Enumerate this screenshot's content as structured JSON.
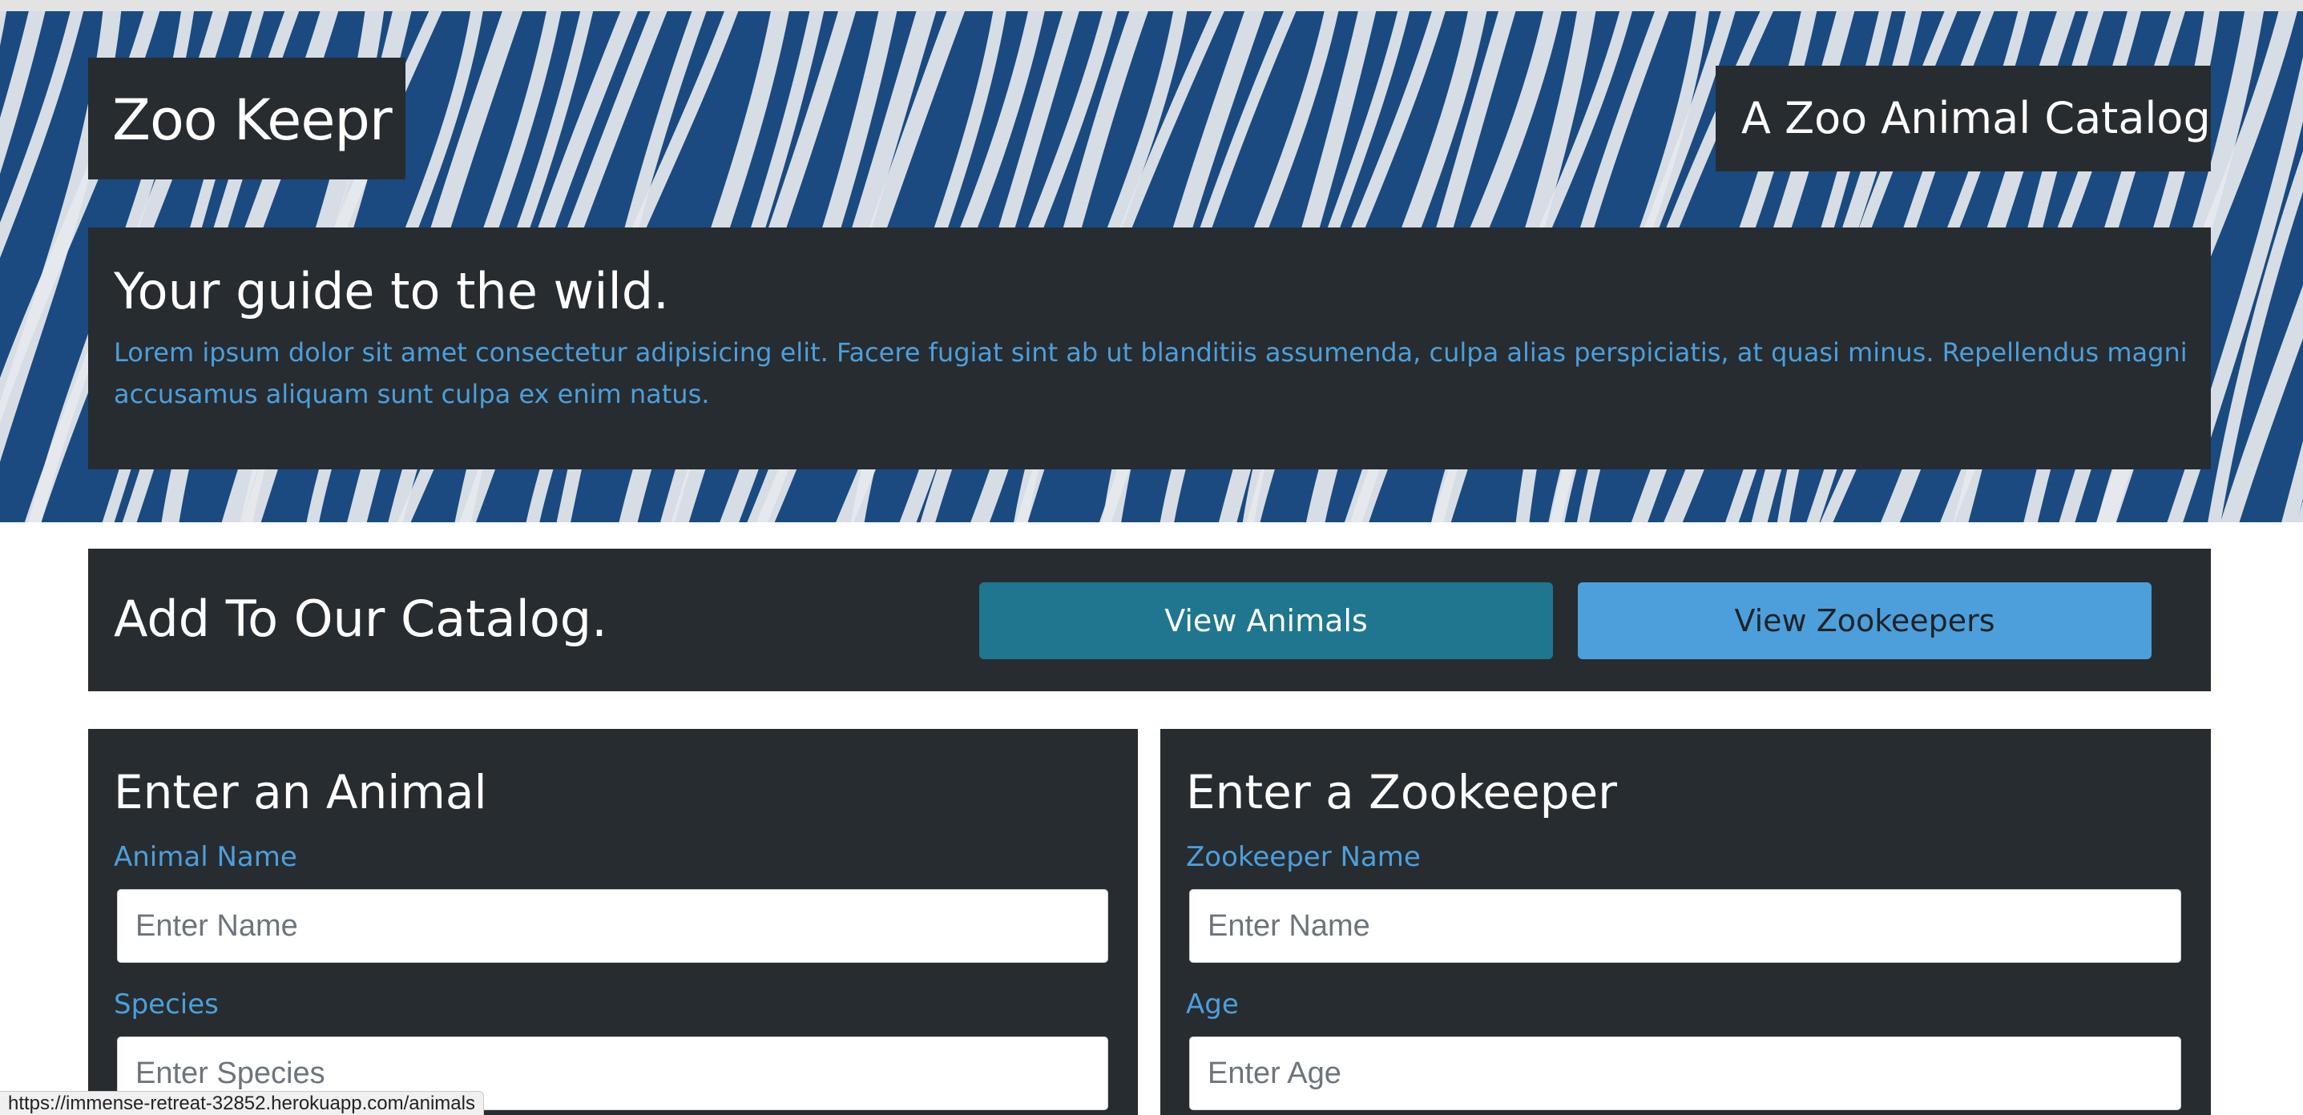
{
  "colors": {
    "panel": "#272c30",
    "accent_blue": "#4d9fdb",
    "teal_button": "#1f768e",
    "hero_blue": "#1a4a80",
    "stripe": "#e6e9ee"
  },
  "hero": {
    "background": "zebra-stripe-photo",
    "brand": "Zoo Keepr",
    "tagline": "A Zoo Animal Catalog",
    "heading": "Your guide to the wild.",
    "body": "Lorem ipsum dolor sit amet consectetur adipisicing elit. Facere fugiat sint ab ut blanditiis assumenda, culpa alias perspiciatis, at quasi minus. Repellendus magni accusamus aliquam sunt culpa ex enim natus."
  },
  "catalog": {
    "heading": "Add To Our Catalog.",
    "view_animals_label": "View Animals",
    "view_zookeepers_label": "View Zookeepers"
  },
  "animal_form": {
    "heading": "Enter an Animal",
    "name_label": "Animal Name",
    "name_placeholder": "Enter Name",
    "name_value": "",
    "species_label": "Species",
    "species_placeholder": "Enter Species",
    "species_value": ""
  },
  "zookeeper_form": {
    "heading": "Enter a Zookeeper",
    "name_label": "Zookeeper Name",
    "name_placeholder": "Enter Name",
    "name_value": "",
    "age_label": "Age",
    "age_placeholder": "Enter Age",
    "age_value": ""
  },
  "status_bar": {
    "url": "https://immense-retreat-32852.herokuapp.com/animals"
  }
}
